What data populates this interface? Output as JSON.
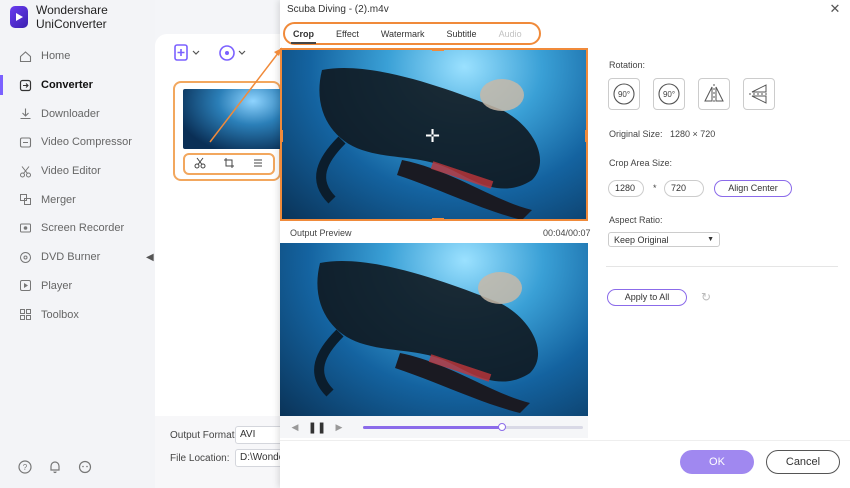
{
  "app": {
    "title": "Wondershare UniConverter"
  },
  "sidebar": {
    "items": [
      {
        "label": "Home",
        "icon": "home-icon",
        "active": false
      },
      {
        "label": "Converter",
        "icon": "converter-icon",
        "active": true
      },
      {
        "label": "Downloader",
        "icon": "download-icon",
        "active": false
      },
      {
        "label": "Video Compressor",
        "icon": "compress-icon",
        "active": false
      },
      {
        "label": "Video Editor",
        "icon": "scissors-icon",
        "active": false
      },
      {
        "label": "Merger",
        "icon": "merge-icon",
        "active": false
      },
      {
        "label": "Screen Recorder",
        "icon": "record-icon",
        "active": false
      },
      {
        "label": "DVD Burner",
        "icon": "disc-icon",
        "active": false
      },
      {
        "label": "Player",
        "icon": "play-icon",
        "active": false
      },
      {
        "label": "Toolbox",
        "icon": "grid-icon",
        "active": false
      }
    ]
  },
  "main": {
    "output_format_label": "Output Format:",
    "output_format_value": "AVI",
    "file_location_label": "File Location:",
    "file_location_value": "D:\\Wonde"
  },
  "dialog": {
    "title": "Scuba Diving - (2).m4v",
    "tabs": [
      {
        "label": "Crop",
        "state": "active"
      },
      {
        "label": "Effect",
        "state": "normal"
      },
      {
        "label": "Watermark",
        "state": "normal"
      },
      {
        "label": "Subtitle",
        "state": "normal"
      },
      {
        "label": "Audio",
        "state": "disabled"
      }
    ],
    "output_preview_label": "Output Preview",
    "time": "00:04/00:07",
    "playback_progress": 0.63,
    "settings": {
      "rotation_label": "Rotation:",
      "rotate_cw_text": "90°",
      "rotate_ccw_text": "90°",
      "original_size_label": "Original Size:",
      "original_size_value": "1280 × 720",
      "crop_area_label": "Crop Area Size:",
      "crop_width": "1280",
      "crop_sep": "*",
      "crop_height": "720",
      "align_center": "Align Center",
      "aspect_ratio_label": "Aspect Ratio:",
      "aspect_ratio_value": "Keep Original",
      "apply_all": "Apply to All"
    },
    "ok": "OK",
    "cancel": "Cancel"
  },
  "colors": {
    "accent": "#8b6bea",
    "highlight": "#f08a3a"
  }
}
